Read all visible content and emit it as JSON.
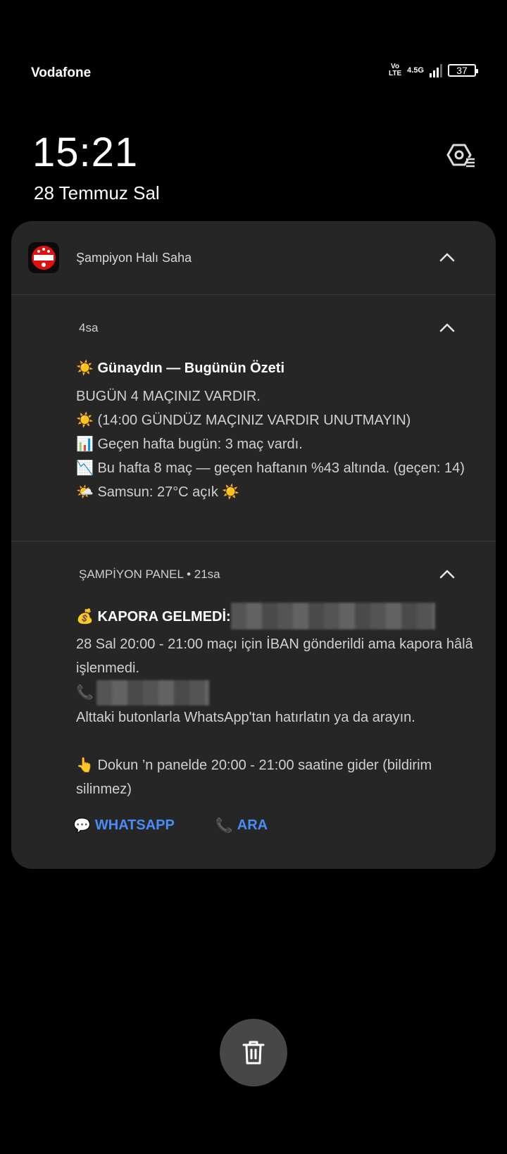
{
  "status_bar": {
    "carrier": "Vodafone",
    "volte_top": "Vo",
    "volte_bottom": "LTE",
    "network": "4.5G",
    "battery": "37"
  },
  "lockscreen": {
    "time": "15:21",
    "date": "28 Temmuz Sal"
  },
  "notification_group": {
    "app_name": "Şampiyon Halı Saha",
    "notifications": [
      {
        "time": "4sa",
        "title": "☀️ Günaydın — Bugünün Özeti",
        "lines": [
          "BUGÜN 4 MAÇINIZ VARDIR.",
          "☀️ (14:00 GÜNDÜZ MAÇINIZ VARDIR UNUTMAYIN)",
          "📊 Geçen hafta bugün: 3 maç vardı.",
          "📉 Bu hafta 8 maç — geçen haftanın %43 altında. (geçen: 14)",
          "🌤️ Samsun: 27°C açık ☀️"
        ]
      },
      {
        "source": "ŞAMPİYON PANEL",
        "time": "21sa",
        "title": "💰 KAPORA GELMEDİ:",
        "lines": [
          "28 Sal 20:00 - 21:00 maçı için İBAN gönderildi ama kapora hâlâ işlenmedi.",
          "📞",
          "Alttaki butonlarla WhatsApp'tan hatırlatın ya da arayın.",
          "",
          "👆 Dokun ’n  panelde 20:00 - 21:00 saatine gider (bildirim silinmez)"
        ],
        "actions": [
          {
            "icon": "💬",
            "label": "WHATSAPP"
          },
          {
            "icon": "📞",
            "label": "ARA"
          }
        ]
      }
    ]
  },
  "colors": {
    "card_bg": "#262626",
    "action_blue": "#4a8cf7",
    "trash_bg": "#474747"
  }
}
